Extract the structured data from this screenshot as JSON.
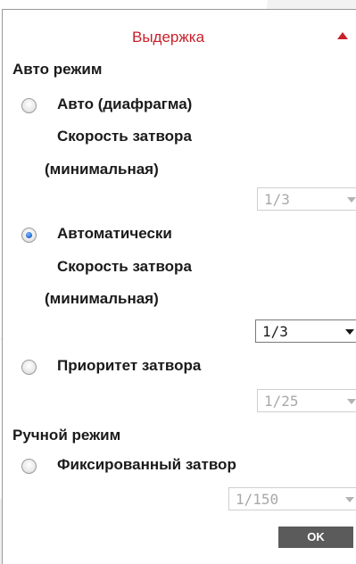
{
  "header": {
    "title": "Выдержка"
  },
  "auto_mode": {
    "section_label": "Авто режим",
    "options": [
      {
        "label": "Авто (диафрагма)",
        "sub1": "Скорость затвора",
        "sub2": "(минимальная)",
        "selected": false,
        "shutter_value": "1/3",
        "select_enabled": false
      },
      {
        "label": "Автоматически",
        "sub1": "Скорость затвора",
        "sub2": "(минимальная)",
        "selected": true,
        "shutter_value": "1/3",
        "select_enabled": true
      },
      {
        "label": "Приоритет затвора",
        "selected": false,
        "shutter_value": "1/25",
        "select_enabled": false
      }
    ]
  },
  "manual_mode": {
    "section_label": "Ручной режим",
    "option": {
      "label": "Фиксированный затвор",
      "selected": false,
      "shutter_value": "1/150",
      "select_enabled": false
    }
  },
  "ok_button": {
    "label": "OK"
  },
  "colors": {
    "accent_red": "#c8202a",
    "button_gray": "#5b5b5b",
    "border_gray": "#9a9a9a"
  }
}
